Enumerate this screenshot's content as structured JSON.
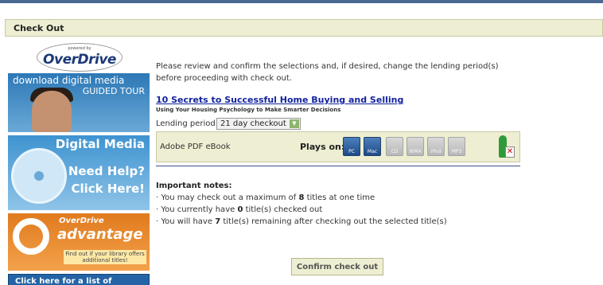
{
  "header": {
    "title": "Check Out"
  },
  "sidebar": {
    "logo": {
      "powered_by": "powered by",
      "brand": "OverDrive"
    },
    "banner_tour": {
      "line1": "download digital media",
      "line2": "GUIDED TOUR"
    },
    "banner_help": {
      "line1": "Digital Media",
      "line2": "Need Help?",
      "line3": "Click Here!"
    },
    "banner_advantage": {
      "line1": "OverDrive",
      "line2": "advantage",
      "line3": "Find out if your library offers additional titles!"
    },
    "banner_list": {
      "label": "Click here for a list of"
    }
  },
  "main": {
    "intro": "Please review and confirm the selections and, if desired, change the lending period(s) before proceeding with check out.",
    "item": {
      "title": "10 Secrets to Successful Home Buying and Selling",
      "subtitle": "Using Your Housing Psychology to Make Smarter Decisions",
      "lending_label": "Lending period:",
      "lending_value": "21 day checkout",
      "format": "Adobe PDF eBook",
      "plays_on_label": "Plays on:",
      "devices": [
        {
          "label": "PC",
          "icon": "pc-icon",
          "active": true
        },
        {
          "label": "Mac",
          "icon": "mac-icon",
          "active": true
        },
        {
          "label": "CD",
          "icon": "cd-icon",
          "active": false
        },
        {
          "label": "WMA",
          "icon": "wma-icon",
          "active": false
        },
        {
          "label": "iPod",
          "icon": "ipod-icon",
          "active": false
        },
        {
          "label": "MP3",
          "icon": "mp3-icon",
          "active": false
        }
      ]
    },
    "notes": {
      "heading": "Important notes:",
      "line1_pre": "· You may check out a maximum of ",
      "line1_num": "8",
      "line1_post": " titles at one time",
      "line2_pre": "· You currently have ",
      "line2_num": "0",
      "line2_post": " title(s) checked out",
      "line3_pre": "· You will have ",
      "line3_num": "7",
      "line3_post": " title(s) remaining after checking out the selected title(s)"
    },
    "confirm_label": "Confirm check out"
  },
  "colors": {
    "accent_bar": "#eeeed2",
    "link": "#13239e",
    "rule": "#3c4f8a"
  }
}
